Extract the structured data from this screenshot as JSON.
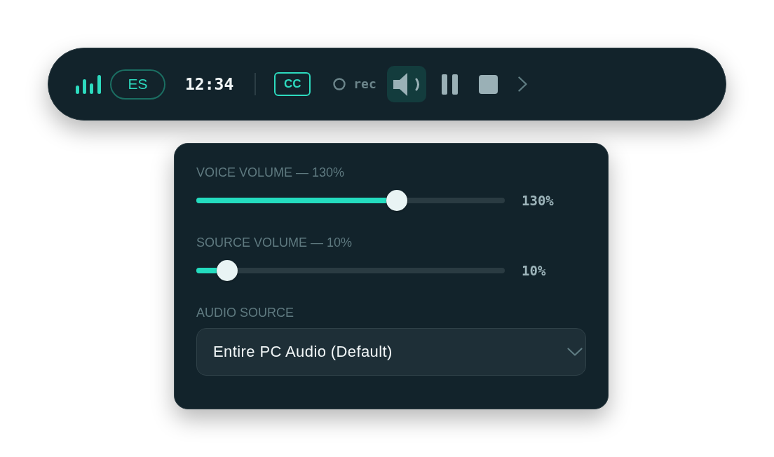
{
  "toolbar": {
    "language": {
      "label": "ES"
    },
    "time": "12:34",
    "captions": {
      "label": "CC",
      "on": true
    },
    "record": {
      "label": "rec",
      "recording": false
    },
    "buttons": [
      {
        "kind": "volume",
        "selected": true
      },
      {
        "kind": "pause",
        "selected": false
      },
      {
        "kind": "stop",
        "selected": false
      },
      {
        "kind": "more",
        "selected": false
      }
    ]
  },
  "volume_panel": {
    "sliders": [
      {
        "label": "VOICE VOLUME — 130%",
        "level": 0.65,
        "reading": "130%"
      },
      {
        "label": "SOURCE VOLUME — 10%",
        "level": 0.1,
        "reading": "10%"
      }
    ],
    "audio_source": {
      "label": "AUDIO SOURCE",
      "value": "Entire PC Audio (Default)"
    }
  }
}
